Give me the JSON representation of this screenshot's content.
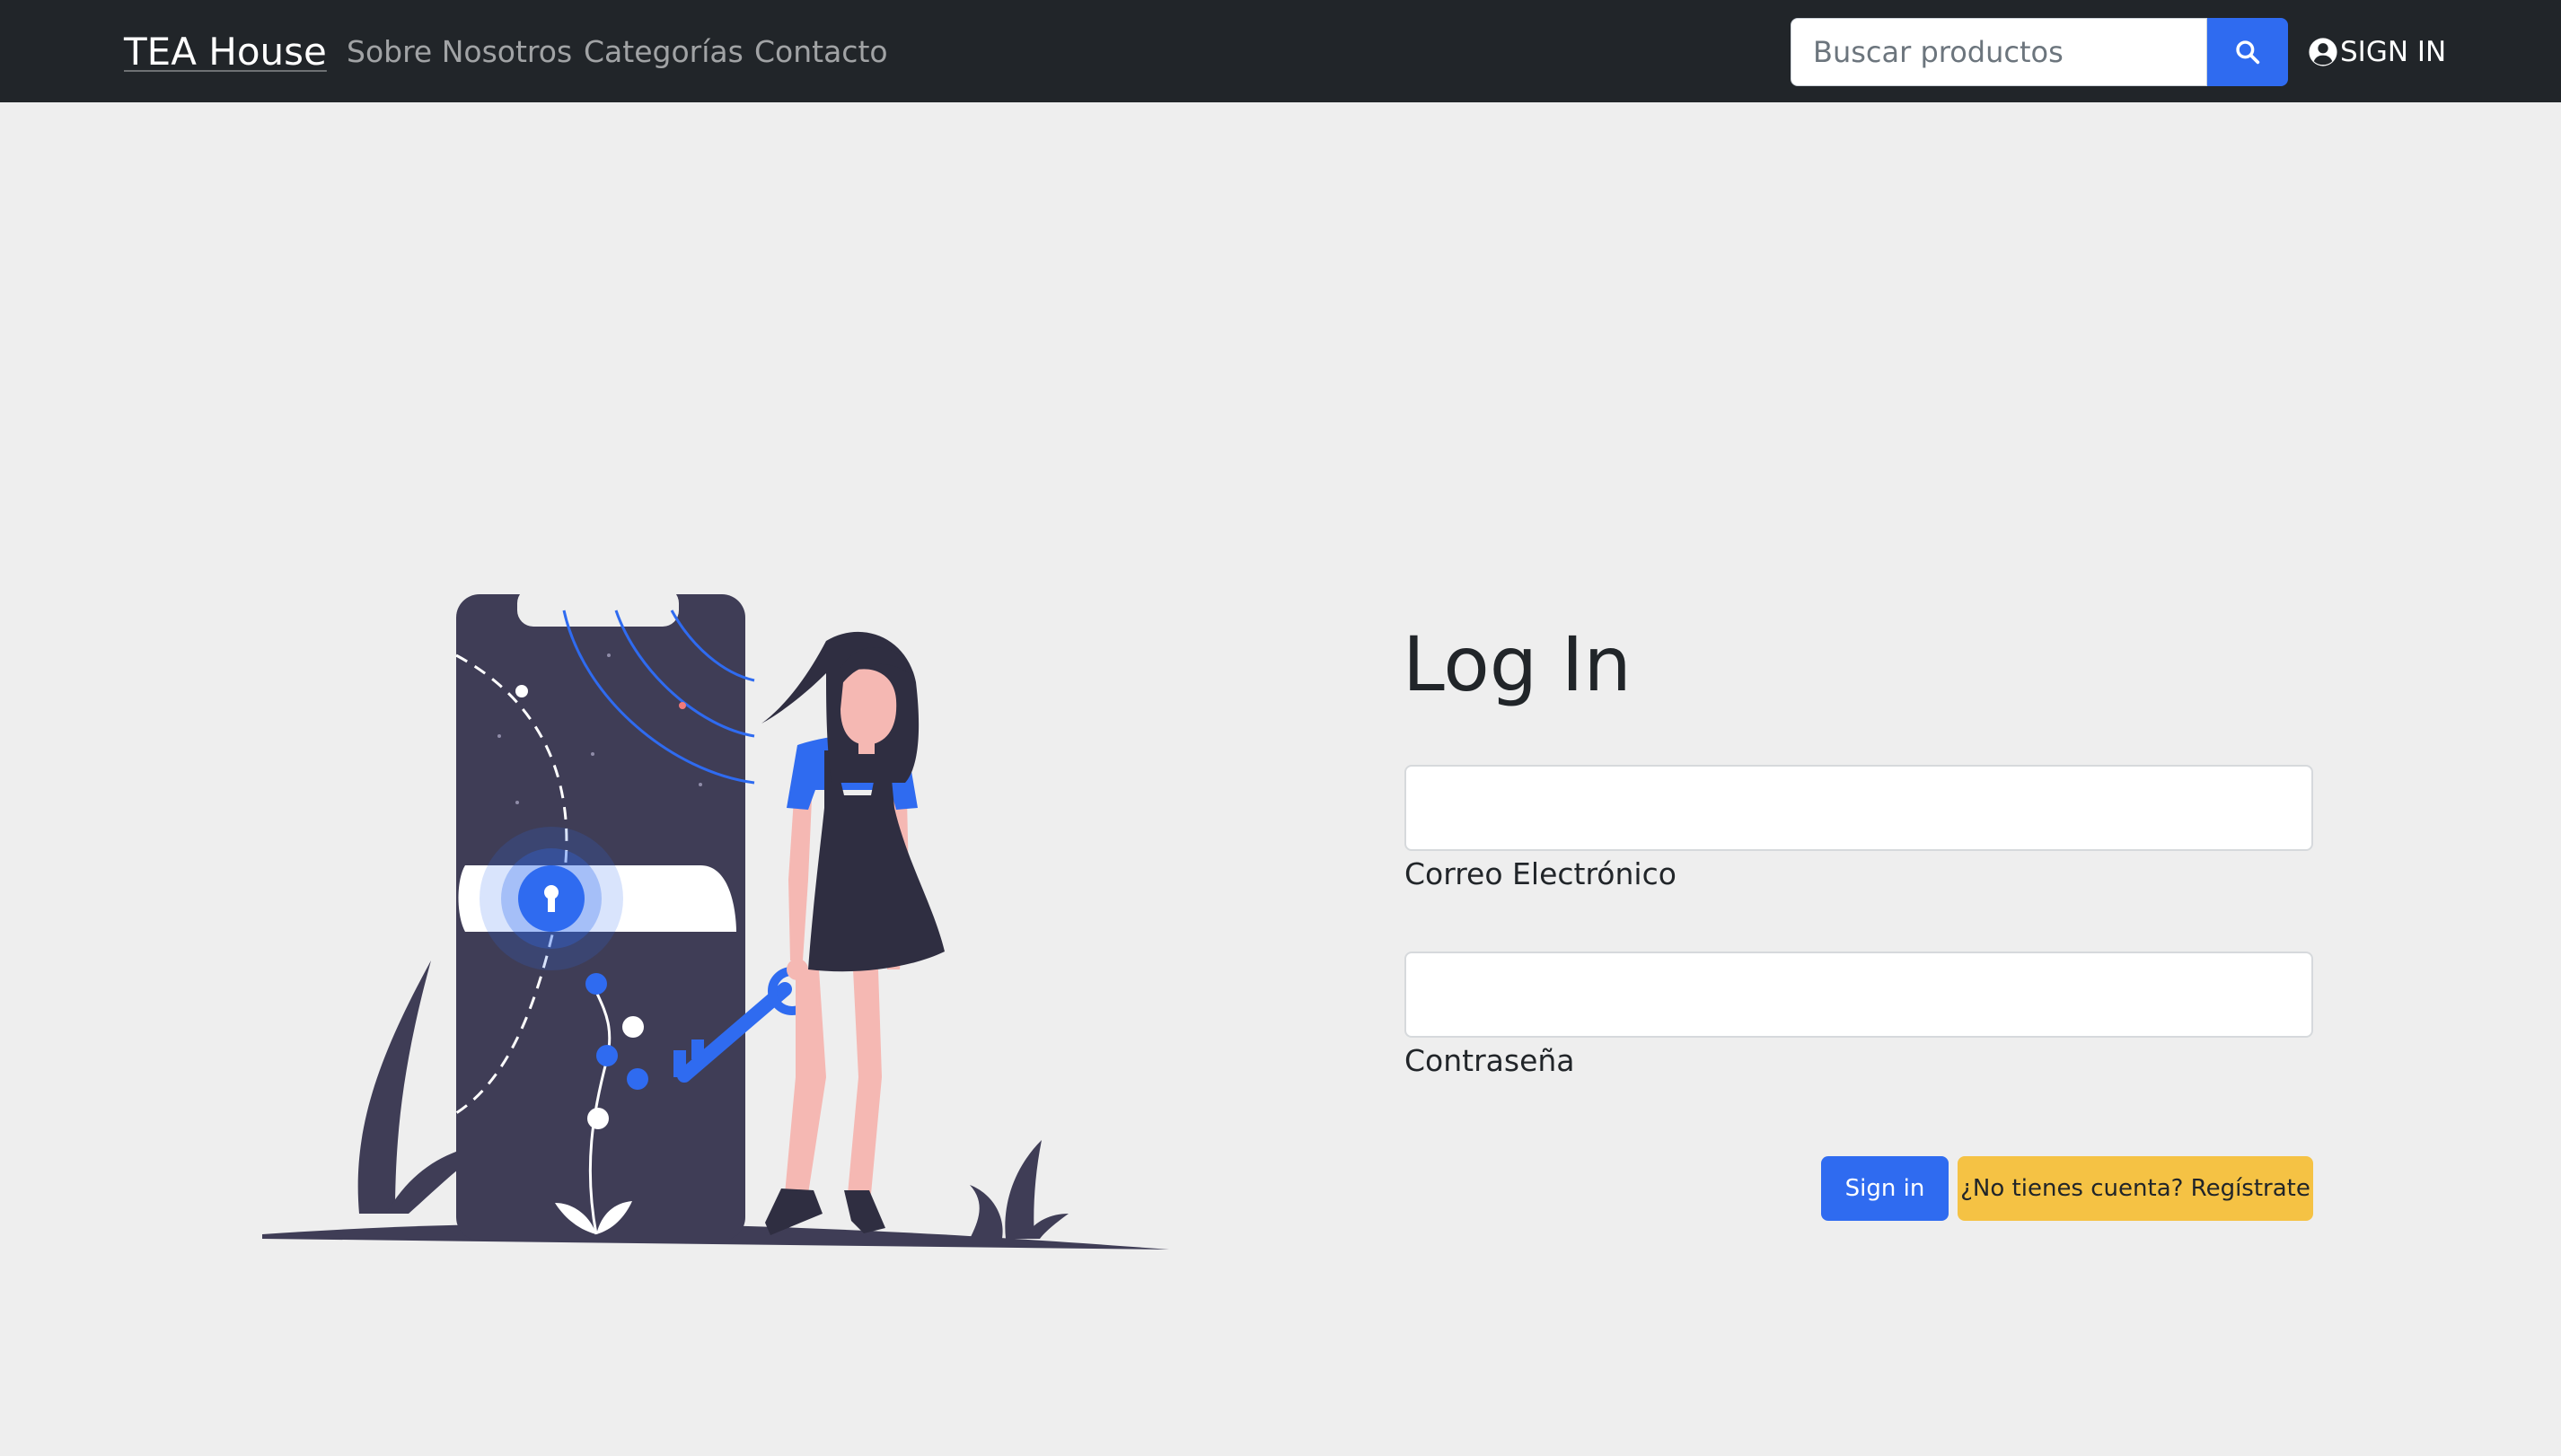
{
  "navbar": {
    "brand": "TEA House",
    "links": [
      "Sobre Nosotros",
      "Categorías",
      "Contacto"
    ],
    "search": {
      "placeholder": "Buscar productos",
      "value": "",
      "icon": "search-icon"
    },
    "signin_label": "SIGN IN",
    "signin_icon": "account-circle-icon"
  },
  "login": {
    "title": "Log In",
    "email_label": "Correo Electrónico",
    "email_value": "",
    "password_label": "Contraseña",
    "password_value": "",
    "submit_label": "Sign in",
    "register_label": "¿No tienes cuenta? Regístrate"
  },
  "colors": {
    "navbar_bg": "#212529",
    "page_bg": "#eeeeee",
    "primary": "#2f6bf0",
    "warning": "#f5c244",
    "illustration_dark": "#3f3d56",
    "illustration_skin": "#f5b8b3"
  }
}
